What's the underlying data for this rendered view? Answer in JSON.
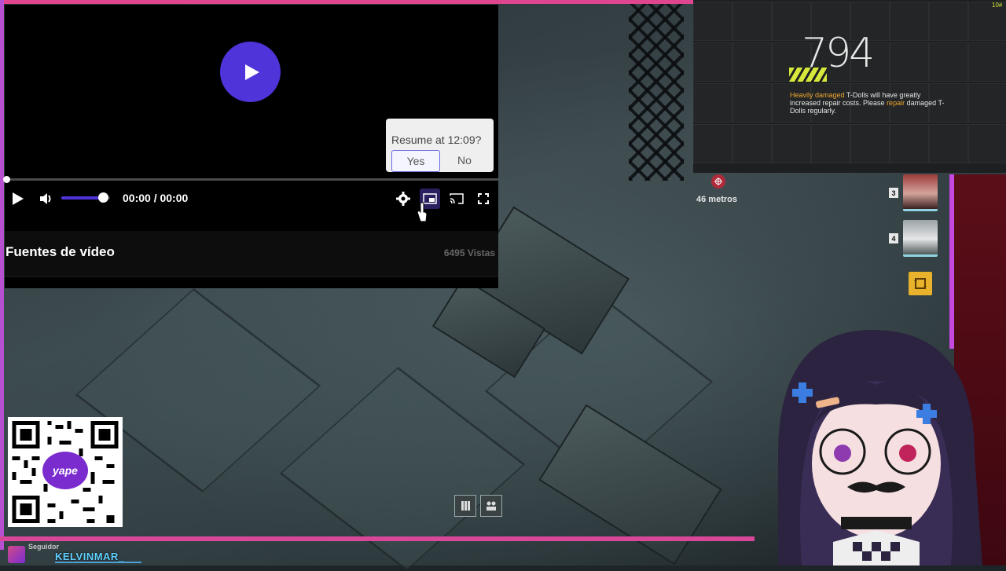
{
  "player": {
    "time_current": "00:00",
    "time_separator": "/",
    "time_total": "00:00",
    "volume_level": 0.85,
    "progress_level": 0,
    "resume_prompt": "Resume at 12:09?",
    "resume_yes": "Yes",
    "resume_no": "No",
    "video_title": "Fuentes de vídeo",
    "video_views": "6495 Vistas",
    "accent_color": "#4f34d9"
  },
  "hud": {
    "score": "794",
    "warning_prefix": "Heavily damaged",
    "warning_mid1": " T-Dolls will have greatly increased repair costs. Please ",
    "warning_highlight2": "repair",
    "warning_suffix": " damaged T-Dolls regularly.",
    "corner_label": "10#",
    "distance": "46 metros",
    "squad": [
      {
        "slot": "3"
      },
      {
        "slot": "4"
      }
    ]
  },
  "qr": {
    "logo_text": "yape"
  },
  "follower": {
    "label": "Seguidor",
    "name": "KELVINMAR_"
  },
  "icons": {
    "play": "play-icon",
    "volume": "volume-icon",
    "settings": "gear-icon",
    "pip": "picture-in-picture-icon",
    "cast": "cast-icon",
    "fullscreen": "fullscreen-icon"
  }
}
